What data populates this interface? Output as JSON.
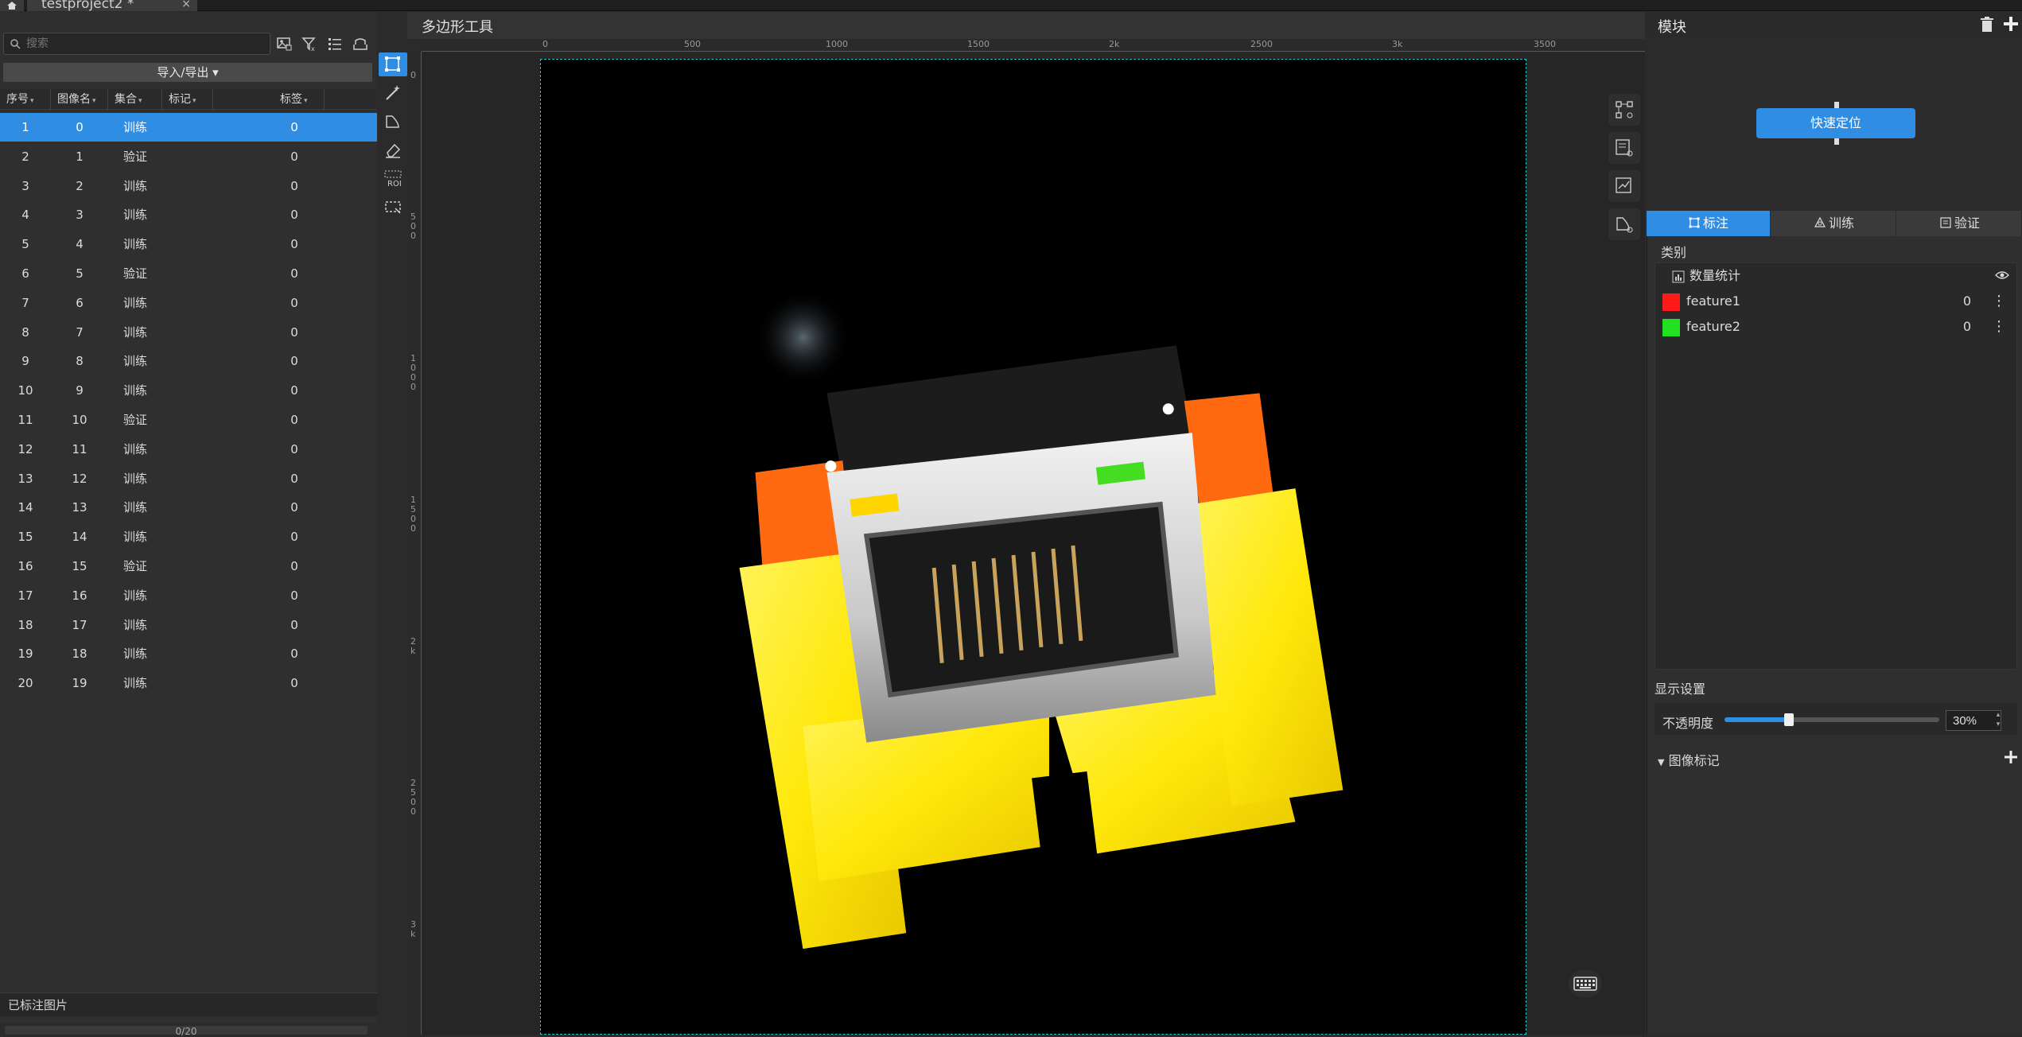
{
  "top_tabs": {
    "project_tab": "testproject2 *",
    "close": "×"
  },
  "left_panel": {
    "search_placeholder": "搜索",
    "import_export": "导入/导出 ▾",
    "columns": [
      "序号",
      "图像名",
      "集合",
      "标记",
      "标签"
    ],
    "rows": [
      {
        "index": "1",
        "name": "0",
        "set": "训练",
        "mark": "",
        "label": "0"
      },
      {
        "index": "2",
        "name": "1",
        "set": "验证",
        "mark": "",
        "label": "0"
      },
      {
        "index": "3",
        "name": "2",
        "set": "训练",
        "mark": "",
        "label": "0"
      },
      {
        "index": "4",
        "name": "3",
        "set": "训练",
        "mark": "",
        "label": "0"
      },
      {
        "index": "5",
        "name": "4",
        "set": "训练",
        "mark": "",
        "label": "0"
      },
      {
        "index": "6",
        "name": "5",
        "set": "验证",
        "mark": "",
        "label": "0"
      },
      {
        "index": "7",
        "name": "6",
        "set": "训练",
        "mark": "",
        "label": "0"
      },
      {
        "index": "8",
        "name": "7",
        "set": "训练",
        "mark": "",
        "label": "0"
      },
      {
        "index": "9",
        "name": "8",
        "set": "训练",
        "mark": "",
        "label": "0"
      },
      {
        "index": "10",
        "name": "9",
        "set": "训练",
        "mark": "",
        "label": "0"
      },
      {
        "index": "11",
        "name": "10",
        "set": "验证",
        "mark": "",
        "label": "0"
      },
      {
        "index": "12",
        "name": "11",
        "set": "训练",
        "mark": "",
        "label": "0"
      },
      {
        "index": "13",
        "name": "12",
        "set": "训练",
        "mark": "",
        "label": "0"
      },
      {
        "index": "14",
        "name": "13",
        "set": "训练",
        "mark": "",
        "label": "0"
      },
      {
        "index": "15",
        "name": "14",
        "set": "训练",
        "mark": "",
        "label": "0"
      },
      {
        "index": "16",
        "name": "15",
        "set": "验证",
        "mark": "",
        "label": "0"
      },
      {
        "index": "17",
        "name": "16",
        "set": "训练",
        "mark": "",
        "label": "0"
      },
      {
        "index": "18",
        "name": "17",
        "set": "训练",
        "mark": "",
        "label": "0"
      },
      {
        "index": "19",
        "name": "18",
        "set": "训练",
        "mark": "",
        "label": "0"
      },
      {
        "index": "20",
        "name": "19",
        "set": "训练",
        "mark": "",
        "label": "0"
      }
    ],
    "footer_label": "已标注图片",
    "footer_pager": "0/20"
  },
  "canvas": {
    "title": "多边形工具",
    "ruler_top_labels": [
      "0",
      "500",
      "1000",
      "1500",
      "2k",
      "2500",
      "3k",
      "3500"
    ],
    "ruler_left_labels": [
      "0",
      "500",
      "1000",
      "1500",
      "2k",
      "2500",
      "3k"
    ],
    "roi_tool_label": "ROI"
  },
  "right_panel": {
    "module_title": "模块",
    "quick_locate": "快速定位",
    "tabs": [
      "标注",
      "训练",
      "验证"
    ],
    "category_label": "类别",
    "stats_label": "数量统计",
    "categories": [
      {
        "name": "feature1",
        "count": "0",
        "color": "#ff1a1a"
      },
      {
        "name": "feature2",
        "count": "0",
        "color": "#22e022"
      }
    ],
    "display_settings": "显示设置",
    "opacity_label": "不透明度",
    "opacity_value": "30%",
    "opacity_fraction": 0.3,
    "image_marks_label": "图像标记"
  },
  "colors": {
    "accent": "#2f8de4",
    "frame_border": "#1fc6c6"
  }
}
